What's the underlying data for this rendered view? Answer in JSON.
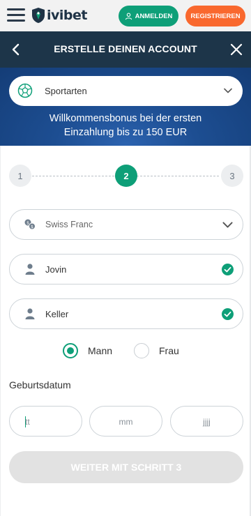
{
  "topbar": {
    "brand": "ivibet",
    "login_label": "ANMELDEN",
    "register_label": "REGISTRIEREN"
  },
  "modal": {
    "title": "ERSTELLE DEINEN ACCOUNT"
  },
  "banner": {
    "sport_select_value": "Sportarten",
    "bonus_line1": "Willkommensbonus bei der ersten",
    "bonus_line2": "Einzahlung bis zu 150 EUR"
  },
  "stepper": {
    "steps": [
      "1",
      "2",
      "3"
    ],
    "active_step": 2
  },
  "form": {
    "currency": "Swiss Franc",
    "first_name": "Jovin",
    "last_name": "Keller",
    "gender_male": "Mann",
    "gender_female": "Frau",
    "gender_selected": "Mann",
    "dob_label": "Geburtsdatum",
    "dob_day_placeholder": "tt",
    "dob_month_placeholder": "mm",
    "dob_year_placeholder": "jjjj",
    "next_button": "WEITER MIT SCHRITT 3"
  },
  "colors": {
    "accent_green": "#0e9f78",
    "register_orange": "#f9682e",
    "header_navy": "#1d3549",
    "banner_blue": "#1d4e92"
  }
}
